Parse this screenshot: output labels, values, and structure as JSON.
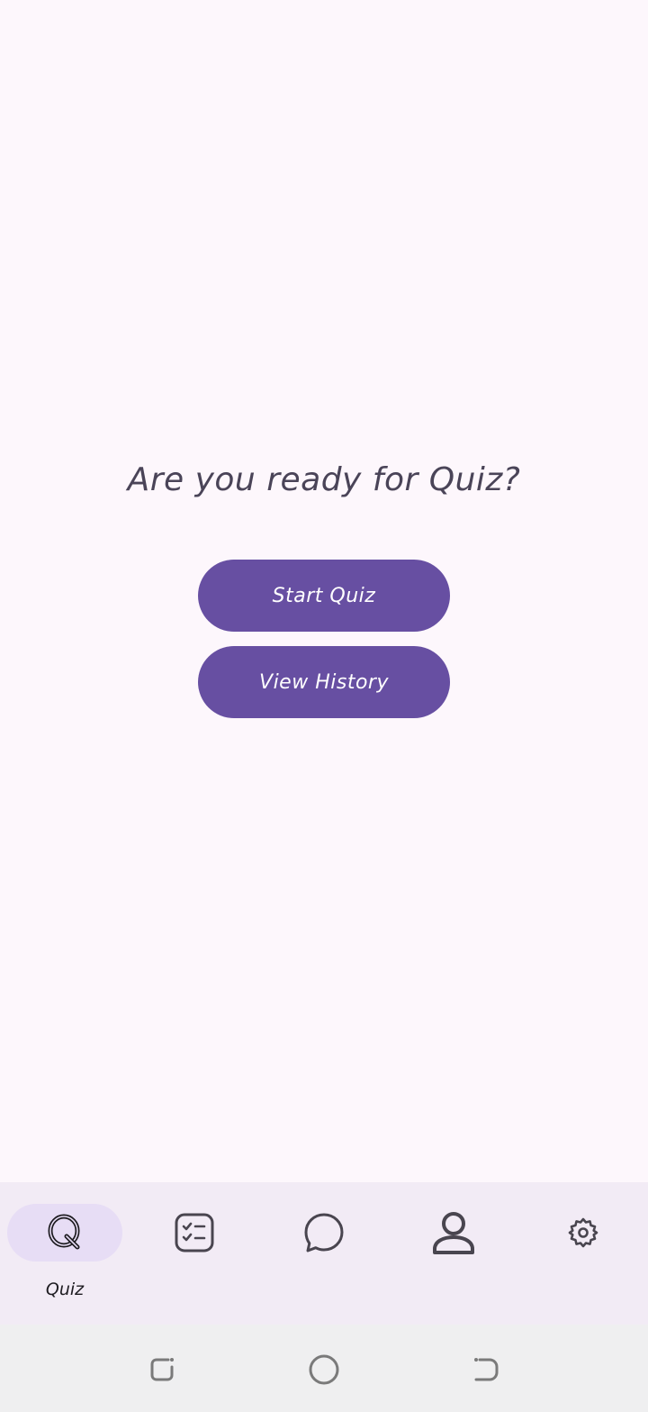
{
  "main": {
    "heading": "Are you ready for Quiz?",
    "start_button": "Start Quiz",
    "history_button": "View History"
  },
  "bottom_nav": {
    "items": [
      {
        "label": "Quiz",
        "icon": "quiz-icon",
        "active": true
      },
      {
        "label": "",
        "icon": "checklist-icon",
        "active": false
      },
      {
        "label": "",
        "icon": "chat-bubble-icon",
        "active": false
      },
      {
        "label": "",
        "icon": "person-icon",
        "active": false
      },
      {
        "label": "",
        "icon": "gear-icon",
        "active": false
      }
    ]
  },
  "colors": {
    "background": "#fdf7fc",
    "primary": "#674fa2",
    "nav_background": "#f2ebf5",
    "nav_active_pill": "#e7ddf5",
    "text": "#4a4458"
  },
  "system_nav": {
    "buttons": [
      "recent-apps-icon",
      "home-icon",
      "back-icon"
    ]
  }
}
